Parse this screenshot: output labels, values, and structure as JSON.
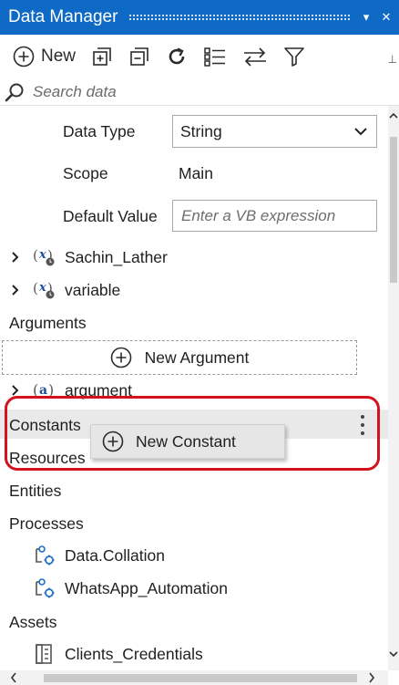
{
  "window": {
    "title": "Data Manager",
    "collapse_glyph": "▾",
    "close_glyph": "✕",
    "pin_glyph": "⊥"
  },
  "toolbar": {
    "new_label": "New",
    "icons": [
      "add-icon",
      "expand-all-icon",
      "collapse-all-icon",
      "refresh-icon",
      "list-view-icon",
      "swap-icon",
      "filter-icon"
    ]
  },
  "search": {
    "placeholder": "Search data"
  },
  "properties": {
    "data_type_label": "Data Type",
    "data_type_value": "String",
    "scope_label": "Scope",
    "scope_value": "Main",
    "default_value_label": "Default Value",
    "default_value_placeholder": "Enter a VB expression"
  },
  "variables": [
    {
      "name": "Sachin_Lather",
      "icon": "variable-icon"
    },
    {
      "name": "variable",
      "icon": "variable-icon"
    }
  ],
  "arguments": {
    "header": "Arguments",
    "new_label": "New Argument",
    "items": [
      {
        "name": "argument",
        "icon": "argument-icon"
      }
    ]
  },
  "constants": {
    "header": "Constants",
    "menu_item": "New Constant"
  },
  "resources": {
    "header": "Resources"
  },
  "entities": {
    "header": "Entities"
  },
  "processes": {
    "header": "Processes",
    "items": [
      {
        "name": "Data.Collation",
        "icon": "process-icon"
      },
      {
        "name": "WhatsApp_Automation",
        "icon": "process-icon"
      }
    ]
  },
  "assets": {
    "header": "Assets",
    "items": [
      {
        "name": "Clients_Credentials",
        "icon": "asset-icon"
      }
    ]
  },
  "colors": {
    "titlebar": "#0f6ac6",
    "highlight": "#d3121e",
    "hover_row": "#e9e9e9"
  }
}
